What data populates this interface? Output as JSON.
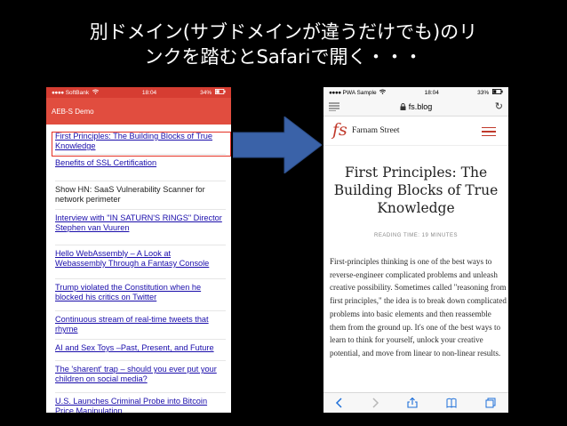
{
  "slide": {
    "title": "別ドメイン(サブドメインが違うだけでも)のリ\nンクを踏むとSafariで開く・・・"
  },
  "left_phone": {
    "status": {
      "carrier": "SoftBank",
      "time": "18:04",
      "battery": "34%"
    },
    "app_title": "AEB-S Demo",
    "stories": [
      {
        "text": "First Principles: The Building Blocks of True Knowledge",
        "link": true
      },
      {
        "text": "Benefits of SSL Certification",
        "link": true
      },
      {
        "text": "Show HN: SaaS Vulnerability Scanner for network perimeter",
        "link": false
      },
      {
        "text": "Interview with \"IN SATURN'S RINGS\" Director Stephen van Vuuren",
        "link": true
      },
      {
        "text": "Hello WebAssembly – A Look at Webassembly Through a Fantasy Console",
        "link": true
      },
      {
        "text": "Trump violated the Constitution when he blocked his critics on Twitter",
        "link": true
      },
      {
        "text": "Continuous stream of real-time tweets that rhyme",
        "link": true
      },
      {
        "text": "AI and Sex Toys –Past, Present, and Future",
        "link": true
      },
      {
        "text": "The 'sharent' trap – should you ever put your children on social media?",
        "link": true
      },
      {
        "text": "U.S. Launches Criminal Probe into Bitcoin Price Manipulation",
        "link": true
      }
    ]
  },
  "right_phone": {
    "status": {
      "carrier": "PWA Sample",
      "time": "18:04",
      "battery": "33%"
    },
    "url": "fs.blog",
    "site_logo": "fs",
    "site_name": "Farnam Street",
    "article_title": "First Principles: The Building Blocks of True Knowledge",
    "reading_time": "READING TIME: 19 MINUTES",
    "article_body": "First-principles thinking is one of the best ways to reverse-engineer complicated problems and unleash creative possibility. Sometimes called \"reasoning from first principles,\" the idea is to break down complicated problems into basic elements and then reassemble them from the ground up. It's one of the best ways to learn to think for yourself, unlock your creative potential, and move from linear to non-linear results."
  },
  "colors": {
    "app_red": "#e14d3f",
    "highlight": "#e53024",
    "arrow": "#3a62a8",
    "link": "#1a0dab",
    "fs_red": "#c0392b"
  },
  "icons": [
    "wifi-icon",
    "battery-icon",
    "lock-icon",
    "reader-icon",
    "reload-icon",
    "back-icon",
    "forward-icon",
    "share-icon",
    "bookmarks-icon",
    "tabs-icon",
    "hamburger-icon",
    "arrow-right-icon"
  ]
}
